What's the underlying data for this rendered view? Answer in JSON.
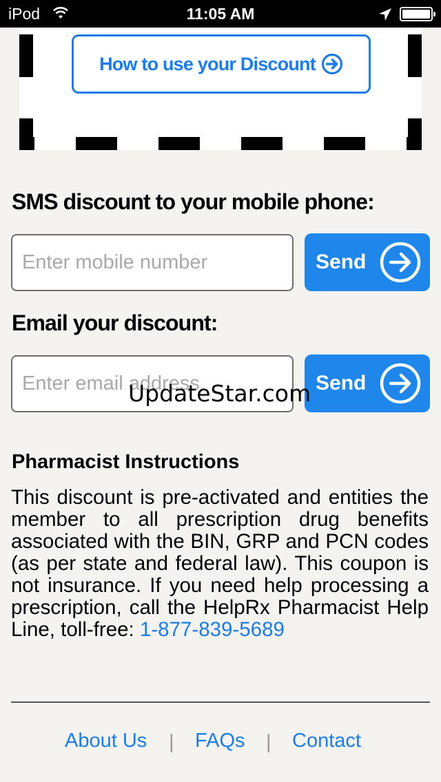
{
  "status_bar": {
    "carrier": "iPod",
    "time": "11:05 AM",
    "icons": [
      "wifi-icon",
      "location-arrow-icon",
      "battery-icon"
    ]
  },
  "coupon": {
    "how_to_label": "How to use your Discount",
    "how_to_icon": "circle-arrow-right-icon"
  },
  "sms": {
    "heading": "SMS discount to your mobile phone:",
    "placeholder": "Enter mobile number",
    "value": "",
    "send_label": "Send"
  },
  "email": {
    "heading": "Email your discount:",
    "placeholder": "Enter email address",
    "value": "",
    "send_label": "Send"
  },
  "watermark": "UpdateStar.com",
  "pharmacist": {
    "heading": "Pharmacist Instructions",
    "body": "This discount is pre-activated and entities the member to all prescription drug benefits associated with the BIN, GRP and PCN codes (as per state and federal law). This coupon is not insurance. If you need help processing a prescription, call the HelpRx Pharmacist Help Line, toll-free: ",
    "phone": "1-877-839-5689"
  },
  "footer": {
    "links": [
      "About Us",
      "FAQs",
      "Contact"
    ],
    "separator": "|"
  },
  "colors": {
    "accent": "#1d7ce6",
    "send_button": "#1f87ec",
    "background": "#f4f3ef",
    "status_bar": "#000000"
  }
}
